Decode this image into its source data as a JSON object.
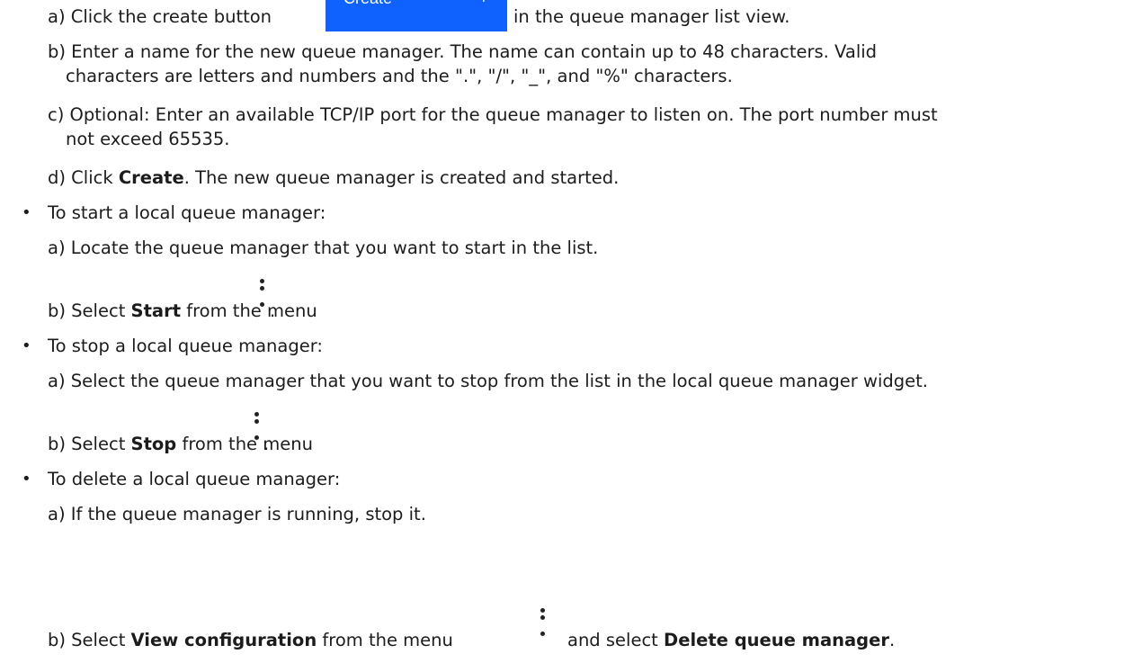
{
  "create_step": {
    "prefix": "a) Click the create button",
    "button_label": "Create",
    "button_plus": "+",
    "suffix": "in the queue manager list view."
  },
  "step_b": {
    "line1": "b) Enter a name for the new queue manager. The name can contain up to 48 characters. Valid",
    "line2": "characters are letters and numbers and the \".\", \"/\", \"_\", and \"%\" characters."
  },
  "step_c": {
    "line1": "c) Optional: Enter an available TCP/IP port for the queue manager to listen on. The port number must",
    "line2": "not exceed 65535."
  },
  "step_d": {
    "prefix": "d) Click ",
    "bold": "Create",
    "suffix": ". The new queue manager is created and started."
  },
  "start_section": {
    "bullet": "•",
    "heading": "To start a local queue manager:",
    "step_a": "a) Locate the queue manager that you want to start in the list.",
    "step_b_prefix": "b) Select ",
    "step_b_bold": "Start",
    "step_b_suffix": " from the menu",
    "step_b_end": "."
  },
  "stop_section": {
    "bullet": "•",
    "heading": "To stop a local queue manager:",
    "step_a": "a) Select the queue manager that you want to stop from the list in the local queue manager widget.",
    "step_b_prefix": "b) Select ",
    "step_b_bold": "Stop",
    "step_b_suffix": " from the menu",
    "step_b_end": "."
  },
  "delete_section": {
    "bullet": "•",
    "heading": "To delete a local queue manager:",
    "step_a": "a) If the queue manager is running, stop it.",
    "step_b_prefix": "b) Select ",
    "step_b_bold": "View configuration",
    "step_b_middle": " from the menu",
    "step_b_and": "and select ",
    "step_b_bold2": "Delete queue manager",
    "step_b_end": "."
  },
  "colors": {
    "button": "#0f62fe",
    "text": "#1c1c1c"
  },
  "icons": [
    "overflow-menu-icon"
  ]
}
